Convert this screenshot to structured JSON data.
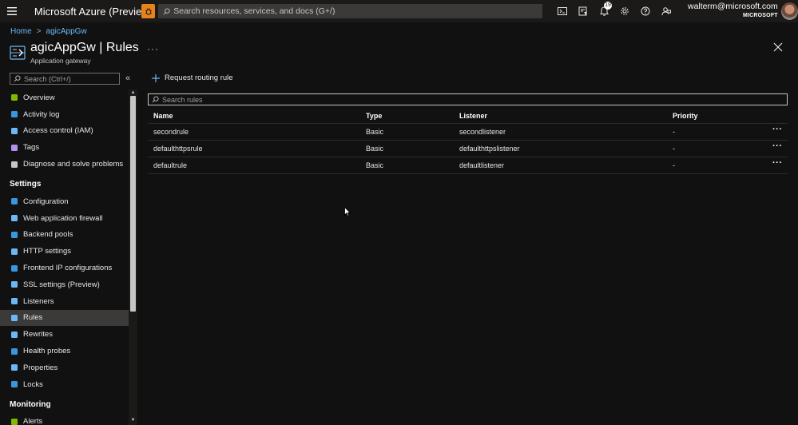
{
  "topbar": {
    "brand": "Microsoft Azure (Preview)",
    "search_placeholder": "Search resources, services, and docs (G+/)",
    "notifications_count": "19",
    "account_email": "walterm@microsoft.com",
    "account_tenant": "MICROSOFT"
  },
  "breadcrumb": {
    "home": "Home",
    "resource": "agicAppGw"
  },
  "header": {
    "title": "agicAppGw | Rules",
    "subtitle": "Application gateway",
    "more": "···"
  },
  "sidebar": {
    "search_placeholder": "Search (Ctrl+/)",
    "collapse": "«",
    "items_top": [
      {
        "label": "Overview",
        "icon": "overview-icon",
        "color": "#7fba00"
      },
      {
        "label": "Activity log",
        "icon": "activity-log-icon",
        "color": "#3a96dd"
      },
      {
        "label": "Access control (IAM)",
        "icon": "iam-icon",
        "color": "#6cb8f6"
      },
      {
        "label": "Tags",
        "icon": "tag-icon",
        "color": "#b48ef0"
      },
      {
        "label": "Diagnose and solve problems",
        "icon": "wrench-icon",
        "color": "#c8c6c4"
      }
    ],
    "settings_head": "Settings",
    "items_settings": [
      {
        "label": "Configuration",
        "icon": "configuration-icon",
        "color": "#3a96dd"
      },
      {
        "label": "Web application firewall",
        "icon": "shield-icon",
        "color": "#6cb8f6"
      },
      {
        "label": "Backend pools",
        "icon": "backend-pools-icon",
        "color": "#3a96dd"
      },
      {
        "label": "HTTP settings",
        "icon": "http-settings-icon",
        "color": "#6cb8f6"
      },
      {
        "label": "Frontend IP configurations",
        "icon": "frontend-ip-icon",
        "color": "#3a96dd"
      },
      {
        "label": "SSL settings (Preview)",
        "icon": "ssl-shield-icon",
        "color": "#6cb8f6"
      },
      {
        "label": "Listeners",
        "icon": "listeners-icon",
        "color": "#6cb8f6"
      },
      {
        "label": "Rules",
        "icon": "rules-icon",
        "color": "#6cb8f6"
      },
      {
        "label": "Rewrites",
        "icon": "rewrites-icon",
        "color": "#6cb8f6"
      },
      {
        "label": "Health probes",
        "icon": "health-probe-icon",
        "color": "#3a96dd"
      },
      {
        "label": "Properties",
        "icon": "properties-icon",
        "color": "#6cb8f6"
      },
      {
        "label": "Locks",
        "icon": "lock-icon",
        "color": "#3a96dd"
      }
    ],
    "monitoring_head": "Monitoring",
    "items_monitoring": [
      {
        "label": "Alerts",
        "icon": "alerts-icon",
        "color": "#7fba00"
      }
    ],
    "active": "Rules"
  },
  "toolbar": {
    "add_rule": "Request routing rule"
  },
  "rules": {
    "search_placeholder": "Search rules",
    "columns": [
      "Name",
      "Type",
      "Listener",
      "Priority"
    ],
    "rows": [
      {
        "name": "secondrule",
        "type": "Basic",
        "listener": "secondlistener",
        "priority": "-"
      },
      {
        "name": "defaulthttpsrule",
        "type": "Basic",
        "listener": "defaulthttpslistener",
        "priority": "-"
      },
      {
        "name": "defaultrule",
        "type": "Basic",
        "listener": "defaultlistener",
        "priority": "-"
      }
    ],
    "row_more": "···"
  },
  "colors": {
    "accent_link": "#6cb8f6",
    "topbar_bg": "#1b1a19",
    "page_bg": "#111111",
    "bug_orange": "#e8821a"
  }
}
